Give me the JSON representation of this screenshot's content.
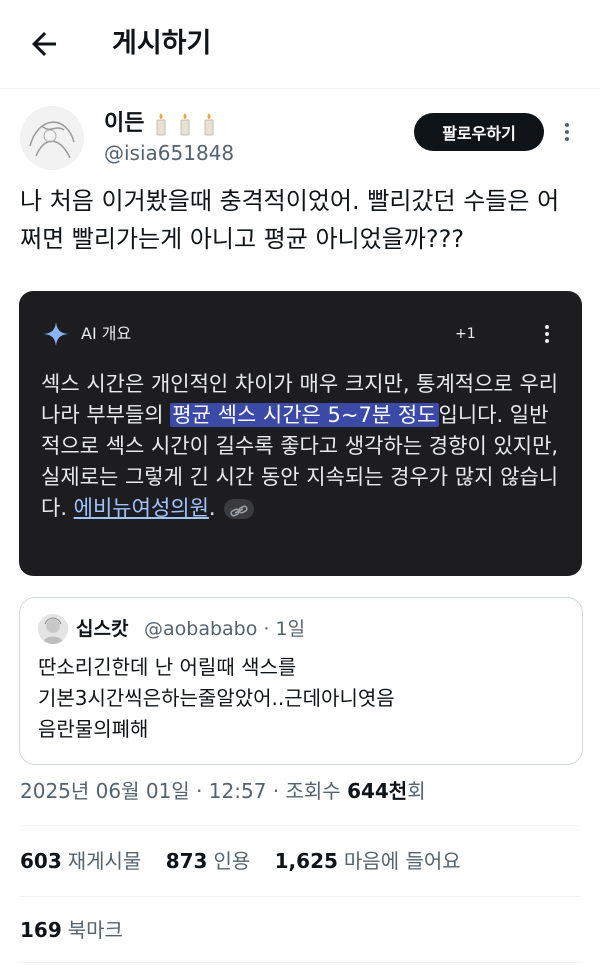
{
  "header": {
    "title": "게시하기",
    "back_icon": "arrow-left-icon"
  },
  "author": {
    "name": "이든",
    "name_emoji": "candle-icon",
    "handle": "@isia651848",
    "follow_label": "팔로우하기"
  },
  "tweet": {
    "text": "나 처음 이거봤을때 충격적이었어. 빨리갔던 수들은 어쩌면 빨리가는게 아니고 평균 아니었을까???"
  },
  "ai_overview": {
    "title": "AI 개요",
    "count": "+1",
    "text_before": "섹스 시간은 개인적인 차이가 매우 크지만, 통계적으로 우리나라 부부들의 ",
    "highlight": "평균 섹스 시간은 5~7분 정도",
    "text_after": "입니다. 일반적으로 섹스 시간이 길수록 좋다고 생각하는 경향이 있지만, 실제로는 그렇게 긴 시간 동안 지속되는 경우가 많지 않습니다. ",
    "source_link": "에비뉴여성의원",
    "period": "."
  },
  "quote": {
    "name": "십스캇",
    "handle_time": "@aobababo · 1일",
    "text_lines": [
      "딴소리긴한데 난 어릴때 색스를",
      "기본3시간씩은하는줄알았어..근데아니엿음",
      "음란물의폐해"
    ]
  },
  "meta": {
    "timestamp": "2025년 06월 01일 · 12:57 · 조회수 ",
    "views": "644천",
    "views_suffix": "회"
  },
  "stats": {
    "retweets": "603",
    "retweets_label": "재게시물",
    "quotes": "873",
    "quotes_label": "인용",
    "likes": "1,625",
    "likes_label": "마음에 들어요",
    "bookmarks": "169",
    "bookmarks_label": "북마크"
  },
  "colors": {
    "accent_dark": "#0f1419",
    "muted": "#536471",
    "ai_bg": "#1d1d1f",
    "highlight": "#3a4aa6",
    "link": "#9fc4ff"
  }
}
